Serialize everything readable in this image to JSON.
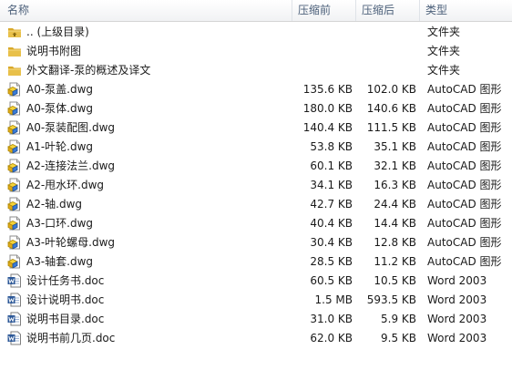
{
  "columns": {
    "name": "名称",
    "packed": "压缩前",
    "original": "压缩后",
    "type": "类型"
  },
  "colors": {
    "folder": "#e8c04a",
    "dwg": "#3a7bd5",
    "doc": "#2b5797",
    "header_text": "#4c607a"
  },
  "files": [
    {
      "icon": "folder-up-icon",
      "name": ".. (上级目录)",
      "packed": "",
      "original": "",
      "type": "文件夹"
    },
    {
      "icon": "folder-icon",
      "name": "说明书附图",
      "packed": "",
      "original": "",
      "type": "文件夹"
    },
    {
      "icon": "folder-icon",
      "name": "外文翻译-泵的概述及译文",
      "packed": "",
      "original": "",
      "type": "文件夹"
    },
    {
      "icon": "dwg-file-icon",
      "name": "A0-泵盖.dwg",
      "packed": "135.6 KB",
      "original": "102.0 KB",
      "type": "AutoCAD 图形"
    },
    {
      "icon": "dwg-file-icon",
      "name": "A0-泵体.dwg",
      "packed": "180.0 KB",
      "original": "140.6 KB",
      "type": "AutoCAD 图形"
    },
    {
      "icon": "dwg-file-icon",
      "name": "A0-泵装配图.dwg",
      "packed": "140.4 KB",
      "original": "111.5 KB",
      "type": "AutoCAD 图形"
    },
    {
      "icon": "dwg-file-icon",
      "name": "A1-叶轮.dwg",
      "packed": "53.8 KB",
      "original": "35.1 KB",
      "type": "AutoCAD 图形"
    },
    {
      "icon": "dwg-file-icon",
      "name": "A2-连接法兰.dwg",
      "packed": "60.1 KB",
      "original": "32.1 KB",
      "type": "AutoCAD 图形"
    },
    {
      "icon": "dwg-file-icon",
      "name": "A2-甩水环.dwg",
      "packed": "34.1 KB",
      "original": "16.3 KB",
      "type": "AutoCAD 图形"
    },
    {
      "icon": "dwg-file-icon",
      "name": "A2-轴.dwg",
      "packed": "42.7 KB",
      "original": "24.4 KB",
      "type": "AutoCAD 图形"
    },
    {
      "icon": "dwg-file-icon",
      "name": "A3-口环.dwg",
      "packed": "40.4 KB",
      "original": "14.4 KB",
      "type": "AutoCAD 图形"
    },
    {
      "icon": "dwg-file-icon",
      "name": "A3-叶轮螺母.dwg",
      "packed": "30.4 KB",
      "original": "12.8 KB",
      "type": "AutoCAD 图形"
    },
    {
      "icon": "dwg-file-icon",
      "name": "A3-轴套.dwg",
      "packed": "28.5 KB",
      "original": "11.2 KB",
      "type": "AutoCAD 图形"
    },
    {
      "icon": "word-doc-icon",
      "name": "设计任务书.doc",
      "packed": "60.5 KB",
      "original": "10.5 KB",
      "type": "Word 2003"
    },
    {
      "icon": "word-doc-icon",
      "name": "设计说明书.doc",
      "packed": "1.5 MB",
      "original": "593.5 KB",
      "type": "Word 2003"
    },
    {
      "icon": "word-doc-icon",
      "name": "说明书目录.doc",
      "packed": "31.0 KB",
      "original": "5.9 KB",
      "type": "Word 2003"
    },
    {
      "icon": "word-doc-icon",
      "name": "说明书前几页.doc",
      "packed": "62.0 KB",
      "original": "9.5 KB",
      "type": "Word 2003"
    }
  ]
}
